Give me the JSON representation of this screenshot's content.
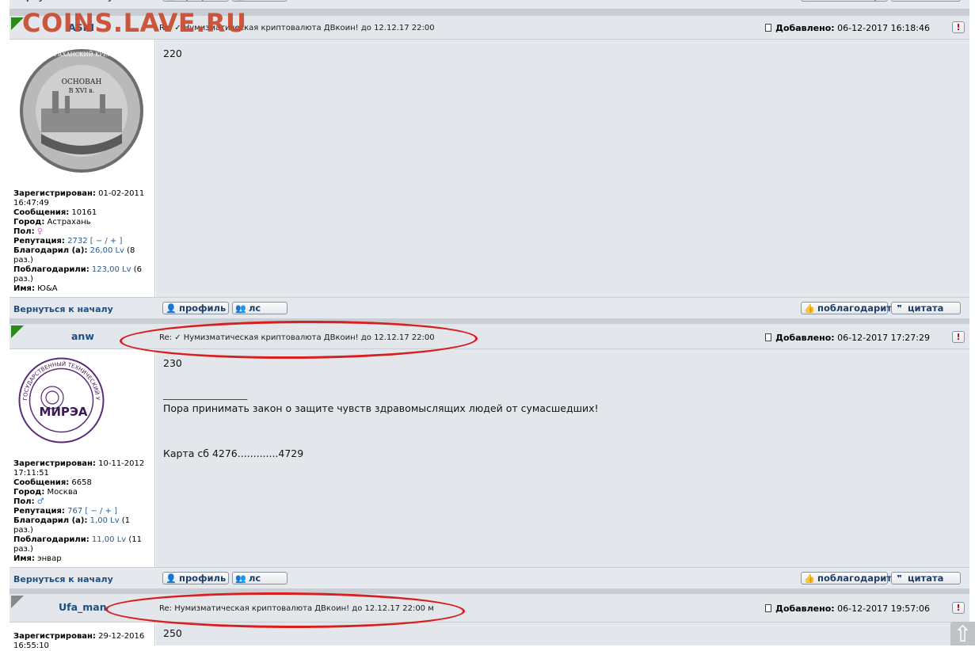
{
  "watermark": "COINS.LAVE.RU",
  "bars": {
    "back_label": "Вернуться к началу",
    "profile_label": "профиль",
    "pm_label": "лс",
    "thank_label": "поблагодарить",
    "quote_label": "цитата"
  },
  "posts": [
    {
      "nick": "ASKI",
      "subject": "Re: ✓ Нумизматическая криптовалюта ДВкоин! до 12.12.17 22:00",
      "added_label": "Добавлено:",
      "added_value": "06-12-2017 16:18:46",
      "body": [
        "220"
      ],
      "avatar_lines": [
        "АСТРАХАНСКИЙ КРЕМЛЬ",
        "ОСНОВАН",
        "В XVI в."
      ],
      "info": {
        "registered_label": "Зарегистрирован:",
        "registered_value": "01-02-2011 16:47:49",
        "messages_label": "Сообщения:",
        "messages_value": "10161",
        "city_label": "Город:",
        "city_value": "Астрахань",
        "gender_label": "Пол:",
        "gender_value": "♀",
        "rep_label": "Репутация:",
        "rep_value": "2732",
        "rep_controls": "[ − / + ]",
        "thanked_label": "Благодарил (а):",
        "thanked_value": "26,00 Lv",
        "thanked_count": "(8 раз.)",
        "gotthanks_label": "Поблагодарили:",
        "gotthanks_value": "123,00 Lv",
        "gotthanks_count": "(6 раз.)",
        "name_label": "Имя:",
        "name_value": "Ю&А"
      }
    },
    {
      "nick": "anw",
      "subject": "Re: ✓ Нумизматическая криптовалюта ДВкоин! до 12.12.17 22:00",
      "added_label": "Добавлено:",
      "added_value": "06-12-2017 17:27:29",
      "body": [
        "230",
        "_________________",
        "Пора принимать закон о защите чувств здравомыслящих людей от сумасшедших!",
        "Карта сб 4276.............4729"
      ],
      "avatar_lines": [
        "ГОСУДАРСТВЕННЫЙ ТЕХНИЧЕСКИЙ УНИВЕРСИТЕТ",
        "МИРЭА"
      ],
      "info": {
        "registered_label": "Зарегистрирован:",
        "registered_value": "10-11-2012 17:11:51",
        "messages_label": "Сообщения:",
        "messages_value": "6658",
        "city_label": "Город:",
        "city_value": "Москва",
        "gender_label": "Пол:",
        "gender_value": "♂",
        "rep_label": "Репутация:",
        "rep_value": "767",
        "rep_controls": "[ − / + ]",
        "thanked_label": "Благодарил (а):",
        "thanked_value": "1,00 Lv",
        "thanked_count": "(1 раз.)",
        "gotthanks_label": "Поблагодарили:",
        "gotthanks_value": "11,00 Lv",
        "gotthanks_count": "(11 раз.)",
        "name_label": "Имя:",
        "name_value": "энвар"
      }
    },
    {
      "nick": "Ufa_man",
      "subject": "Re: Нумизматическая криптовалюта ДВкоин! до 12.12.17 22:00 м",
      "added_label": "Добавлено:",
      "added_value": "06-12-2017 19:57:06",
      "body": [
        "250"
      ],
      "info": {
        "registered_label": "Зарегистрирован:",
        "registered_value": "29-12-2016 16:55:10"
      }
    }
  ],
  "icons": {
    "profile": "user-icon",
    "pm": "users-icon",
    "thank": "thumbs-up-icon",
    "quote": "quote-icon",
    "warn": "report-icon",
    "doc": "document-icon",
    "scroll": "arrow-up-icon"
  }
}
